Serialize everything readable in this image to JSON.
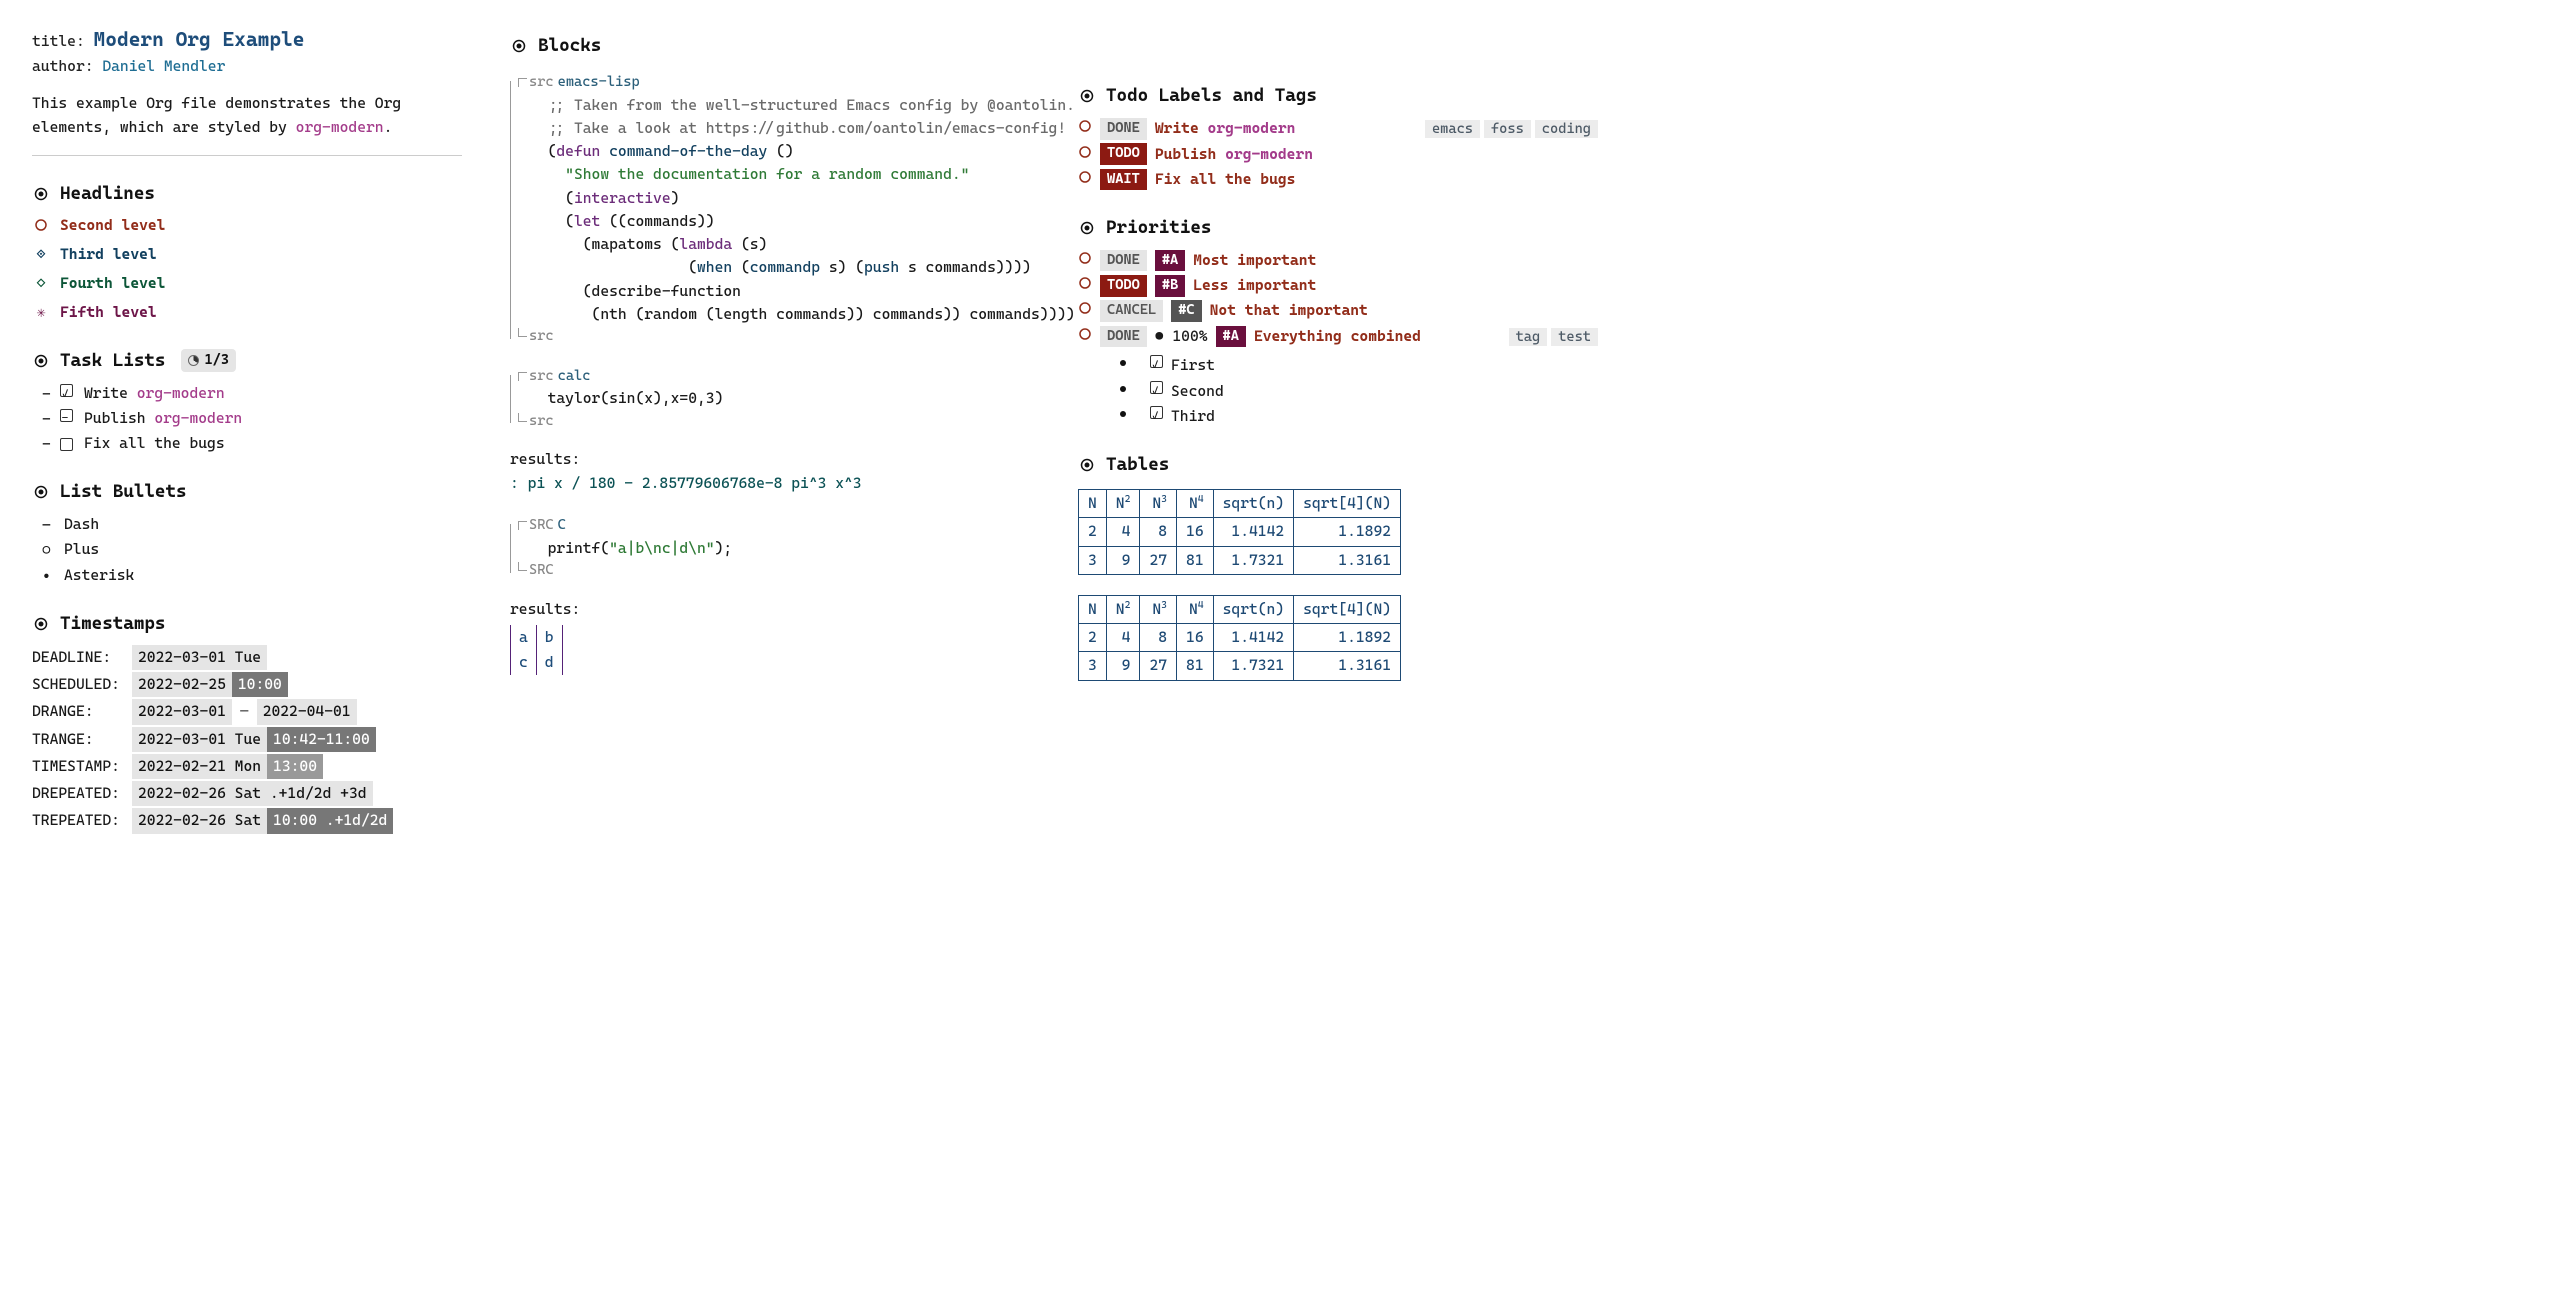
{
  "meta": {
    "title_kw": "title:",
    "title_val": "Modern Org Example",
    "author_kw": "author:",
    "author_val": "Daniel Mendler",
    "intro_a": "This example Org file demonstrates the Org elements, which are styled by ",
    "intro_pkg": "org-modern",
    "intro_b": "."
  },
  "headlines": {
    "heading": "Headlines",
    "h2": "Second level",
    "h3": "Third level",
    "h4": "Fourth level",
    "h5": "Fifth level"
  },
  "tasks": {
    "heading": "Task Lists",
    "stat": "1/3",
    "items": [
      {
        "pre": "-",
        "state": "on",
        "text_a": "Write ",
        "pkg": "org-modern",
        "text_b": ""
      },
      {
        "pre": "-",
        "state": "pipe",
        "text_a": "Publish ",
        "pkg": "org-modern",
        "text_b": ""
      },
      {
        "pre": "-",
        "state": "off",
        "text_a": "Fix all the bugs",
        "pkg": "",
        "text_b": ""
      }
    ]
  },
  "bullets": {
    "heading": "List Bullets",
    "items": [
      {
        "sym": "–",
        "label": "Dash"
      },
      {
        "sym": "○",
        "label": "Plus"
      },
      {
        "sym": "•",
        "label": "Asterisk"
      }
    ]
  },
  "timestamps": {
    "heading": "Timestamps",
    "rows": [
      {
        "key": "DEADLINE:",
        "date": "2022-03-01 Tue",
        "time": ""
      },
      {
        "key": "SCHEDULED:",
        "date": "2022-02-25",
        "time": "10:00"
      },
      {
        "key": "DRANGE:",
        "date": "2022-03-01",
        "dash": "—",
        "date2": "2022-04-01"
      },
      {
        "key": "TRANGE:",
        "date": "2022-03-01 Tue",
        "time": "10:42-11:00"
      },
      {
        "key": "TIMESTAMP:",
        "date": "2022-02-21 Mon",
        "time_lt": "13:00"
      },
      {
        "key": "DREPEATED:",
        "date": "2022-02-26 Sat .+1d/2d +3d"
      },
      {
        "key": "TREPEATED:",
        "date": "2022-02-26 Sat",
        "time": "10:00 .+1d/2d"
      }
    ]
  },
  "blocks": {
    "heading": "Blocks",
    "src_tag": "src",
    "SRC_tag": "SRC",
    "lang1": "emacs-lisp",
    "lang2": "calc",
    "lang3": "C",
    "elisp_comment1": ";; Taken from the well-structured Emacs config by @oantolin.",
    "elisp_comment2": ";; Take a look at https://github.com/oantolin/emacs-config!",
    "defun": "defun",
    "fnname": "command-of-the-day",
    "empty_args": "()",
    "docstr": "\"Show the documentation for a random command.\"",
    "interactive": "interactive",
    "let": "let",
    "commands": "commands",
    "mapatoms": "mapatoms",
    "lambda": "lambda",
    "s_arg": "(s)",
    "when": "when",
    "commandp": "commandp",
    "s_sym": "s",
    "push": "push",
    "close_when": " commands))))",
    "describe_fn": "describe-function",
    "nth": "nth",
    "random": "random",
    "length": "length",
    "close_all": " commands)) commands))))",
    "calc_body": "taylor(sin(x),x=0,3)",
    "results_label": "results:",
    "results1": ": pi x / 180 - 2.85779606768e-8 pi^3 x^3",
    "c_body_a": "printf(",
    "c_body_str": "\"a|b\\nc|d\\n\"",
    "c_body_b": ");",
    "rtab": [
      [
        "a",
        "b"
      ],
      [
        "c",
        "d"
      ]
    ]
  },
  "todos": {
    "heading": "Todo Labels and Tags",
    "rows": [
      {
        "pill": "DONE",
        "pill_cls": "done",
        "text_a": "Write ",
        "pkg": "org-modern",
        "tags": [
          "emacs",
          "foss",
          "coding"
        ]
      },
      {
        "pill": "TODO",
        "pill_cls": "todo",
        "text_a": "Publish ",
        "pkg": "org-modern"
      },
      {
        "pill": "WAIT",
        "pill_cls": "wait",
        "text_a": "Fix all the bugs"
      }
    ]
  },
  "priorities": {
    "heading": "Priorities",
    "rows": [
      {
        "pill": "DONE",
        "pill_cls": "done",
        "prio": "#A",
        "prio_cls": "prio",
        "text": "Most important"
      },
      {
        "pill": "TODO",
        "pill_cls": "todo",
        "prio": "#B",
        "prio_cls": "prio",
        "text": "Less important"
      },
      {
        "pill": "CANCEL",
        "pill_cls": "cancel",
        "prio": "#C",
        "prio_cls": "prio-lt",
        "text": "Not that important"
      },
      {
        "pill": "DONE",
        "pill_cls": "done",
        "prog": "● 100%",
        "prio": "#A",
        "prio_cls": "prio",
        "text": "Everything combined",
        "tags": [
          "tag",
          "test"
        ]
      }
    ],
    "checks": [
      "First",
      "Second",
      "Third"
    ]
  },
  "tables": {
    "heading": "Tables",
    "headers": [
      "N",
      "N2",
      "N3",
      "N4",
      "sqrt(n)",
      "sqrt[4](N)"
    ],
    "rows": [
      [
        "2",
        "4",
        "8",
        "16",
        "1.4142",
        "1.1892"
      ],
      [
        "3",
        "9",
        "27",
        "81",
        "1.7321",
        "1.3161"
      ]
    ]
  }
}
